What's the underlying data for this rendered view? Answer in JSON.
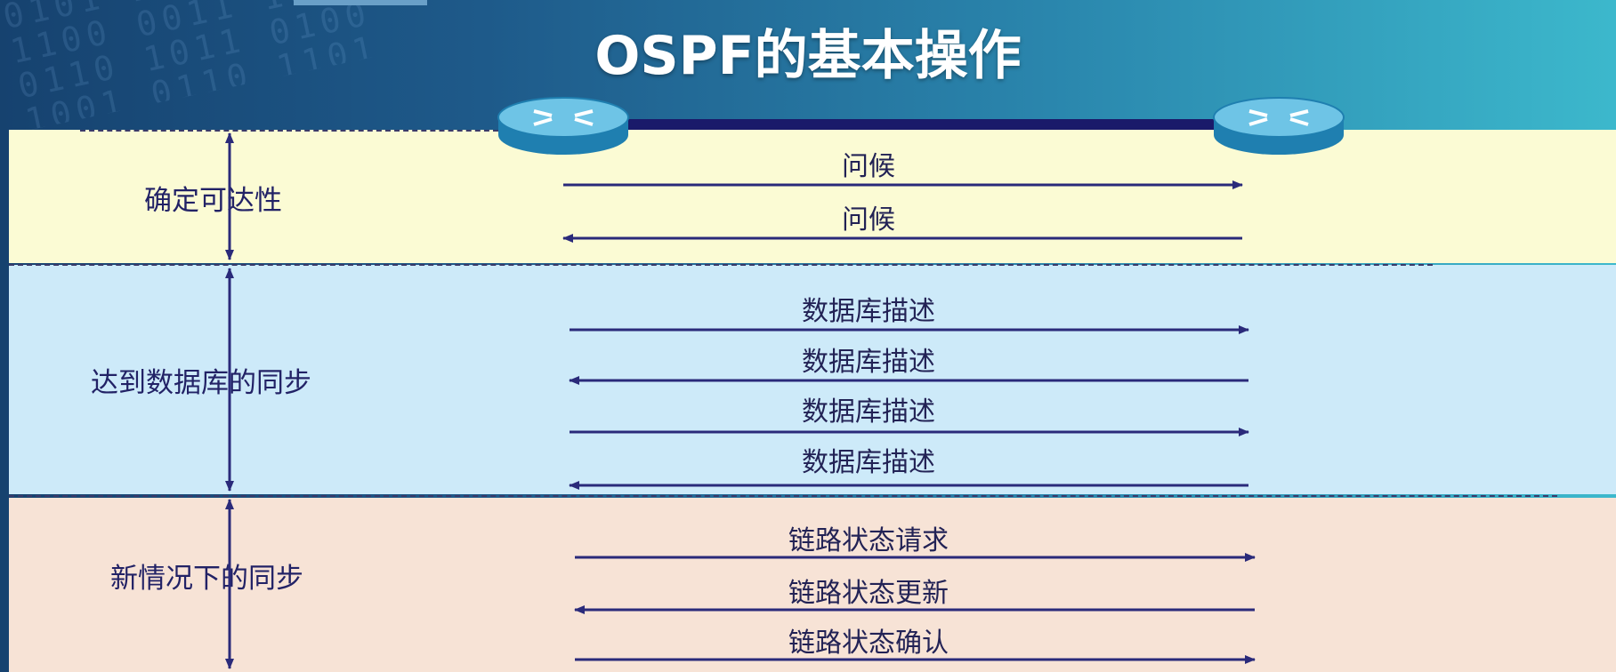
{
  "title": "OSPF的基本操作",
  "colors": {
    "arrow": "#2a2a7a",
    "link": "#1a1a6a",
    "router_top": "#6ec4e6",
    "router_side": "#1f7fb0"
  },
  "icons": {
    "left_router": "router-icon",
    "right_router": "router-icon"
  },
  "phases": [
    {
      "label": "确定可达性",
      "messages": [
        {
          "label": "问候",
          "direction": "right"
        },
        {
          "label": "问候",
          "direction": "left"
        }
      ]
    },
    {
      "label": "达到数据库的同步",
      "messages": [
        {
          "label": "数据库描述",
          "direction": "right"
        },
        {
          "label": "数据库描述",
          "direction": "left"
        },
        {
          "label": "数据库描述",
          "direction": "right"
        },
        {
          "label": "数据库描述",
          "direction": "left"
        }
      ]
    },
    {
      "label": "新情况下的同步",
      "messages": [
        {
          "label": "链路状态请求",
          "direction": "right"
        },
        {
          "label": "链路状态更新",
          "direction": "left"
        },
        {
          "label": "链路状态确认",
          "direction": "right"
        }
      ]
    }
  ]
}
